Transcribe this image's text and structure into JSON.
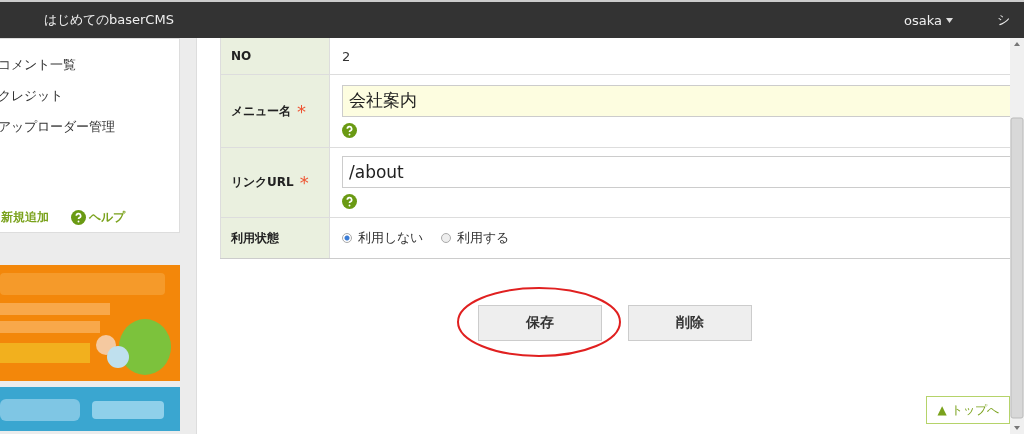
{
  "header": {
    "title": "はじめてのbaserCMS",
    "user": "osaka",
    "cut_label": "シ"
  },
  "sidebar": {
    "items": [
      {
        "label": "コメント一覧"
      },
      {
        "label": "クレジット"
      },
      {
        "label": "アップローダー管理"
      }
    ],
    "actions": [
      {
        "label": "新規追加",
        "kind": "add"
      },
      {
        "label": "ヘルプ",
        "kind": "help"
      }
    ]
  },
  "form": {
    "rows": [
      {
        "label": "NO",
        "kind": "text",
        "value": "2"
      },
      {
        "label": "メニュー名",
        "kind": "input",
        "value": "会社案内",
        "required_mark": "*",
        "highlighted": true
      },
      {
        "label": "リンクURL",
        "kind": "input",
        "value": "/about",
        "required_mark": "*",
        "highlighted": false
      },
      {
        "label": "利用状態",
        "kind": "radio",
        "options": [
          {
            "label": "利用しない",
            "selected": true
          },
          {
            "label": "利用する",
            "selected": false
          }
        ]
      }
    ]
  },
  "buttons": [
    {
      "label": "保存"
    },
    {
      "label": "削除"
    }
  ],
  "annotation": {
    "kind": "ellipse"
  },
  "top_link": {
    "label": "▲ トップへ"
  }
}
